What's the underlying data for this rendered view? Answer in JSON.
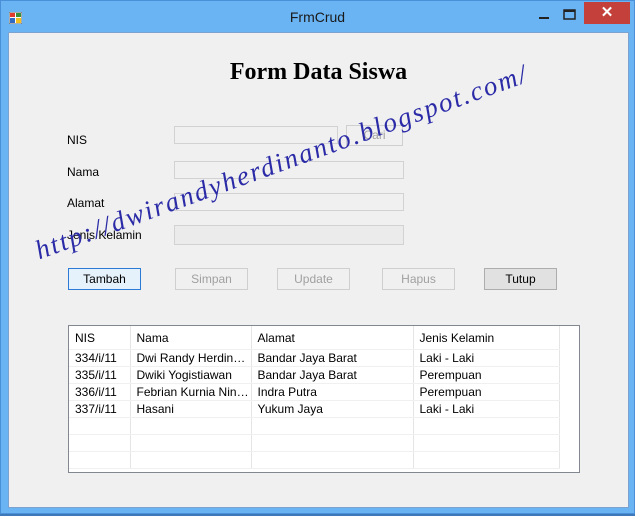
{
  "window": {
    "title": "FrmCrud"
  },
  "form": {
    "heading": "Form Data Siswa",
    "labels": {
      "nis": "NIS",
      "nama": "Nama",
      "alamat": "Alamat",
      "jenis_kelamin": "Jenis Kelamin"
    },
    "fields": {
      "nis": "",
      "nama": "",
      "alamat": "",
      "jenis_kelamin": ""
    },
    "buttons": {
      "cari": "Cari",
      "tambah": "Tambah",
      "simpan": "Simpan",
      "update": "Update",
      "hapus": "Hapus",
      "tutup": "Tutup"
    }
  },
  "grid": {
    "columns": [
      "NIS",
      "Nama",
      "Alamat",
      "Jenis Kelamin"
    ],
    "rows": [
      [
        "334/i/11",
        "Dwi Randy Herdinanto",
        "Bandar Jaya Barat",
        "Laki - Laki"
      ],
      [
        "335/i/11",
        "Dwiki Yogistiawan",
        "Bandar Jaya Barat",
        "Perempuan"
      ],
      [
        "336/i/11",
        "Febrian Kurnia Ningr...",
        "Indra Putra",
        "Perempuan"
      ],
      [
        "337/i/11",
        "Hasani",
        "Yukum Jaya",
        "Laki - Laki"
      ]
    ]
  },
  "watermark": "http://dwirandyherdinanto.blogspot.com/"
}
